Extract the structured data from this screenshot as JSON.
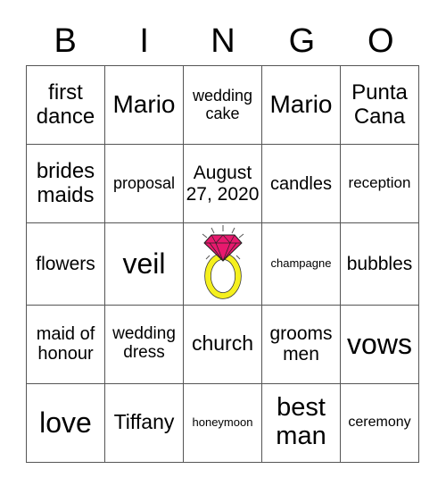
{
  "header": {
    "letters": [
      "B",
      "I",
      "N",
      "G",
      "O"
    ]
  },
  "rows": [
    [
      "first dance",
      "Mario",
      "wedding cake",
      "Mario",
      "Punta Cana"
    ],
    [
      "brides maids",
      "proposal",
      "August 27, 2020",
      "candles",
      "reception"
    ],
    [
      "flowers",
      "veil",
      "",
      "champagne",
      "bubbles"
    ],
    [
      "maid of honour",
      "wedding dress",
      "church",
      "grooms men",
      "vows"
    ],
    [
      "love",
      "Tiffany",
      "honeymoon",
      "best man",
      "ceremony"
    ]
  ],
  "free_space": {
    "icon": "diamond-ring-icon",
    "gem_color": "#e8196e",
    "ring_color": "#f5f01e"
  }
}
